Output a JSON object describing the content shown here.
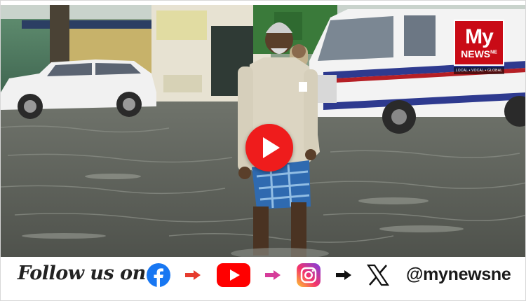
{
  "logo": {
    "brand_top": "My",
    "brand_bottom": "NEWS",
    "brand_suffix": "NE",
    "tagline": "LOCAL • VOCAL • GLOBAL",
    "color": "#c90b16"
  },
  "player": {
    "play_icon": "play-icon",
    "button_color": "#ef1c1c"
  },
  "follow": {
    "label": "Follow us on",
    "handle": "@mynewsne",
    "icons": [
      "facebook-icon",
      "youtube-icon",
      "instagram-icon",
      "x-icon"
    ],
    "arrow_colors": [
      "#e63b2e",
      "#d63c9a",
      "#111111"
    ]
  }
}
